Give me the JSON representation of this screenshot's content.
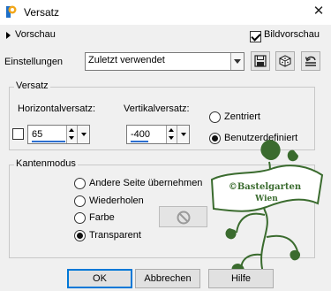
{
  "window": {
    "title": "Versatz",
    "close_glyph": "✕"
  },
  "preview": {
    "label": "Vorschau",
    "bildvorschau_label": "Bildvorschau",
    "bildvorschau_checked": true
  },
  "settings": {
    "label": "Einstellungen",
    "preset_value": "Zuletzt verwendet"
  },
  "versatz": {
    "title": "Versatz",
    "horizontal_label": "Horizontalversatz:",
    "horizontal_value": "65",
    "vertical_label": "Vertikalversatz:",
    "vertical_value": "-400",
    "link_checked": false,
    "zentriert_label": "Zentriert",
    "benutzerdefiniert_label": "Benutzerdefiniert",
    "selected": "benutzerdefiniert"
  },
  "kantenmodus": {
    "title": "Kantenmodus",
    "options": [
      "Andere Seite übernehmen",
      "Wiederholen",
      "Farbe",
      "Transparent"
    ],
    "selected": "Transparent"
  },
  "buttons": {
    "ok": "OK",
    "cancel": "Abbrechen",
    "help": "Hilfe"
  },
  "watermark": {
    "line1": "©Bastelgarten",
    "line2": "Wien",
    "color": "#3a6b2e"
  }
}
